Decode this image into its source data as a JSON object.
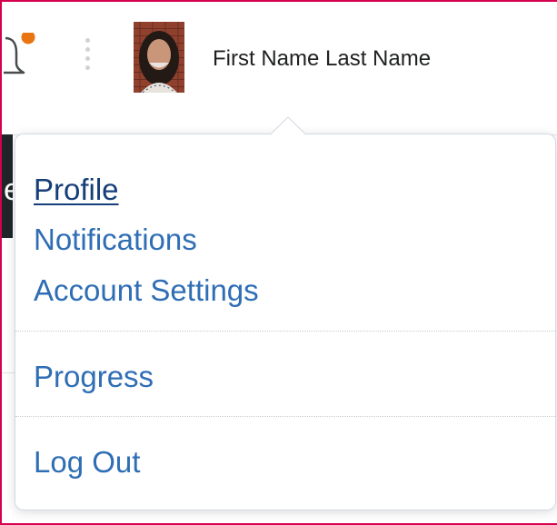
{
  "header": {
    "user_name": "First Name Last Name",
    "notification_dot_color": "#e87511",
    "notification_icon": "bell-icon",
    "more_icon": "vertical-dots-icon"
  },
  "dropdown": {
    "groups": [
      [
        {
          "label": "Profile",
          "active": true
        },
        {
          "label": "Notifications",
          "active": false
        },
        {
          "label": "Account Settings",
          "active": false
        }
      ],
      [
        {
          "label": "Progress",
          "active": false
        }
      ],
      [
        {
          "label": "Log Out",
          "active": false
        }
      ]
    ]
  },
  "colors": {
    "link": "#2f6eb5",
    "link_active": "#163e7a",
    "highlight_frame": "#d6004f"
  }
}
